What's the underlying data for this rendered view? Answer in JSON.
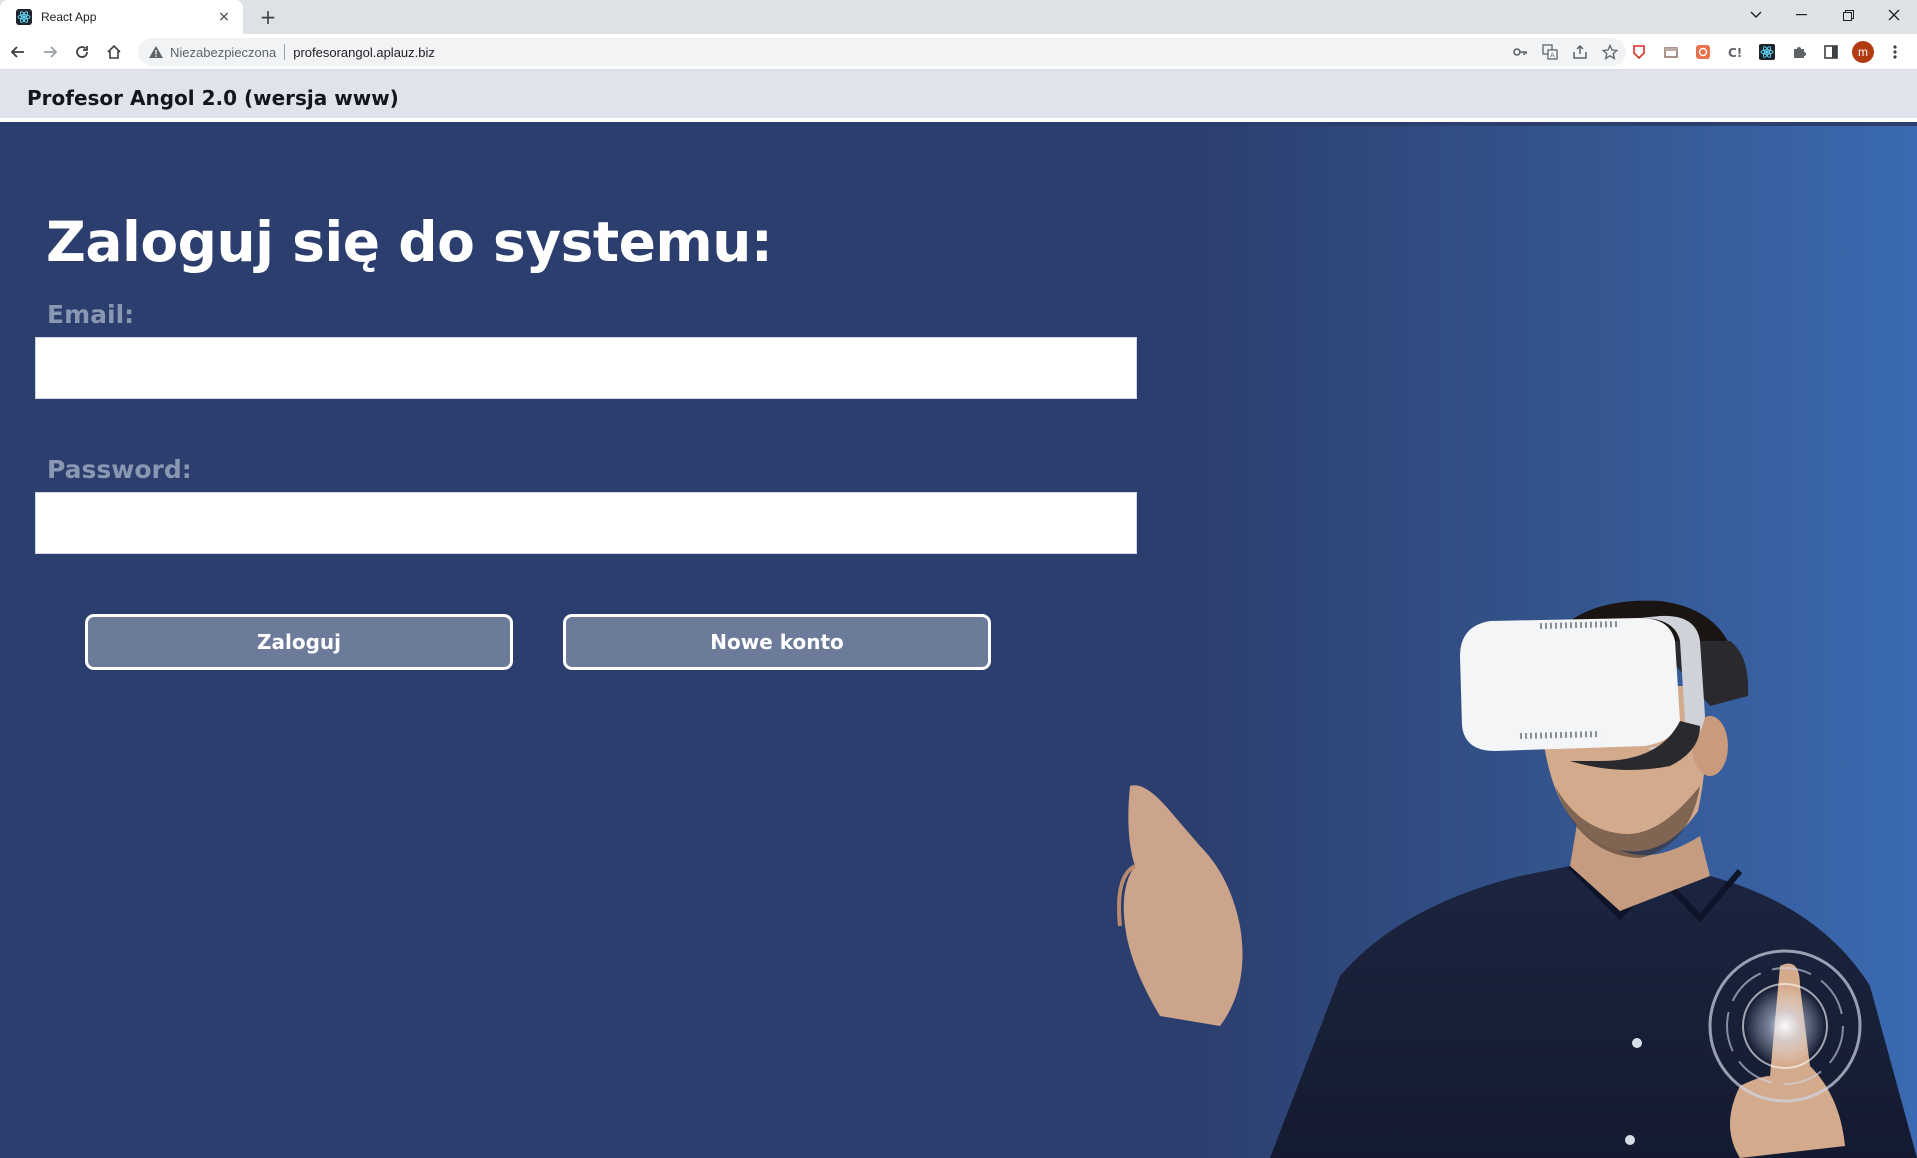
{
  "browser": {
    "tab_title": "React App",
    "tab_close": "×",
    "new_tab": "+",
    "security_status": "Niezabezpieczona",
    "url": "profesorangol.aplauz.biz",
    "avatar_letter": "m"
  },
  "app": {
    "title": "Profesor Angol 2.0 (wersja www)"
  },
  "login": {
    "heading": "Zaloguj się do systemu:",
    "email_label": "Email:",
    "email_value": "",
    "password_label": "Password:",
    "password_value": "",
    "login_button": "Zaloguj",
    "register_button": "Nowe konto"
  },
  "colors": {
    "background": "#2c3e6e",
    "button": "#6d7b9b",
    "label": "#8a97b3",
    "header": "#dfe4ec"
  }
}
